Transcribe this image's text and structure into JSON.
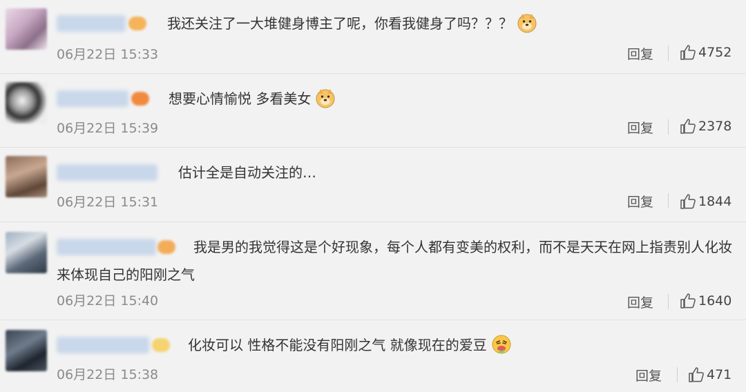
{
  "comments": [
    {
      "text": "我还关注了一大堆健身博主了呢，你看我健身了吗？？？",
      "emoji": "doge-emoji",
      "time": "06月22日 15:33",
      "reply_label": "回复",
      "likes": "4752"
    },
    {
      "text": "想要心情愉悦 多看美女",
      "emoji": "doge-emoji",
      "time": "06月22日 15:39",
      "reply_label": "回复",
      "likes": "2378"
    },
    {
      "text": "估计全是自动关注的…",
      "emoji": "",
      "time": "06月22日 15:31",
      "reply_label": "回复",
      "likes": "1844"
    },
    {
      "text": "我是男的我觉得这是个好现象，每个人都有变美的权利，而不是天天在网上指责别人化妆来体现自己的阳刚之气",
      "emoji": "",
      "time": "06月22日 15:40",
      "reply_label": "回复",
      "likes": "1640"
    },
    {
      "text": "化妆可以 性格不能没有阳刚之气 就像现在的爱豆",
      "emoji": "vomit-emoji",
      "time": "06月22日 15:38",
      "reply_label": "回复",
      "likes": "471"
    }
  ],
  "colors": {
    "background": "#f2f2f2",
    "name_blur": "#c9d7ea",
    "time": "#8a8a8a",
    "divider": "#e0e0e0"
  }
}
